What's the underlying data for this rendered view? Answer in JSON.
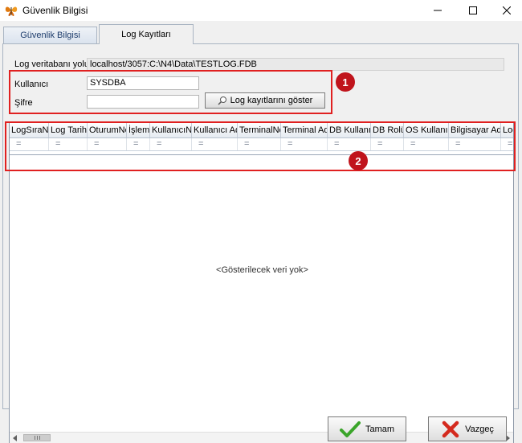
{
  "window": {
    "title": "Güvenlik Bilgisi",
    "controls": {
      "minimize": "—",
      "maximize": "☐",
      "close": "✕"
    }
  },
  "tabs": [
    {
      "label": "Güvenlik Bilgisi",
      "active": false
    },
    {
      "label": "Log Kayıtları",
      "active": true
    }
  ],
  "form": {
    "db_path_label": "Log veritabanı yolu",
    "db_path_value": "localhost/3057:C:\\N4\\Data\\TESTLOG.FDB",
    "user_label": "Kullanıcı",
    "user_value": "SYSDBA",
    "password_label": "Şifre",
    "password_value": "",
    "show_button": "Log kayıtlarını göster"
  },
  "annotations": {
    "badge1": "1",
    "badge2": "2"
  },
  "grid": {
    "columns": [
      "LogSıraNo",
      "Log Tarihi",
      "OturumNo",
      "İşlem",
      "KullanıcıNo",
      "Kullanıcı Adı",
      "TerminalNo",
      "Terminal Adı",
      "DB Kullanıcı",
      "DB Rolü",
      "OS Kullanıcı",
      "Bilgisayar Adı",
      "Log"
    ],
    "filter_symbol": "=",
    "empty_text": "<Gösterilecek veri yok>"
  },
  "buttons": {
    "ok": "Tamam",
    "cancel": "Vazgeç"
  },
  "colors": {
    "annotation_red": "#e02020",
    "ok_icon": "#3aa52a",
    "cancel_icon": "#d42a1e"
  }
}
